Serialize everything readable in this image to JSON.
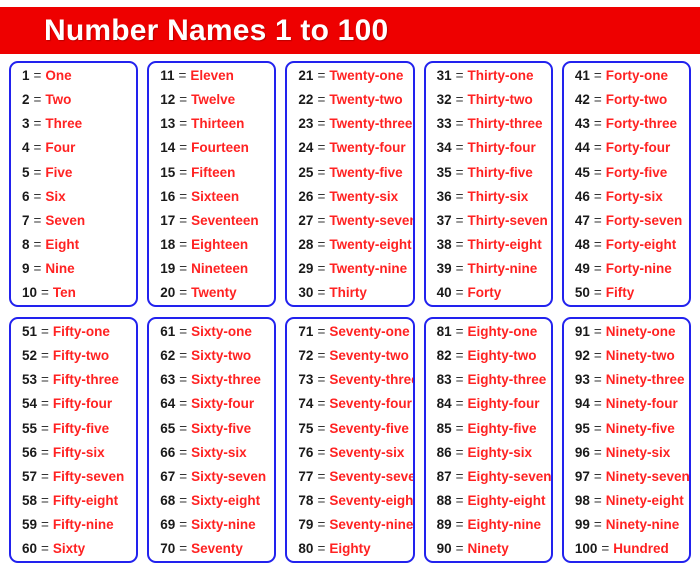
{
  "header": {
    "title": "Number Names 1 to 100",
    "banner_color": "#ee0000",
    "title_color": "#ffffff"
  },
  "style": {
    "card_border_color": "#2222ee",
    "number_color": "#1a1a1a",
    "equals_symbol": "=",
    "name_color": "#ff2222"
  },
  "cards": [
    {
      "card_name": "card-1-to-10",
      "entries": [
        {
          "number": "1",
          "eq": "=",
          "name": "One"
        },
        {
          "number": "2",
          "eq": "=",
          "name": "Two"
        },
        {
          "number": "3",
          "eq": "=",
          "name": "Three"
        },
        {
          "number": "4",
          "eq": "=",
          "name": "Four"
        },
        {
          "number": "5",
          "eq": "=",
          "name": "Five"
        },
        {
          "number": "6",
          "eq": "=",
          "name": "Six"
        },
        {
          "number": "7",
          "eq": "=",
          "name": "Seven"
        },
        {
          "number": "8",
          "eq": "=",
          "name": "Eight"
        },
        {
          "number": "9",
          "eq": "=",
          "name": "Nine"
        },
        {
          "number": "10",
          "eq": "=",
          "name": "Ten"
        }
      ]
    },
    {
      "card_name": "card-11-to-20",
      "entries": [
        {
          "number": "11",
          "eq": "=",
          "name": "Eleven"
        },
        {
          "number": "12",
          "eq": "=",
          "name": "Twelve"
        },
        {
          "number": "13",
          "eq": "=",
          "name": "Thirteen"
        },
        {
          "number": "14",
          "eq": "=",
          "name": "Fourteen"
        },
        {
          "number": "15",
          "eq": "=",
          "name": "Fifteen"
        },
        {
          "number": "16",
          "eq": "=",
          "name": "Sixteen"
        },
        {
          "number": "17",
          "eq": "=",
          "name": "Seventeen"
        },
        {
          "number": "18",
          "eq": "=",
          "name": "Eighteen"
        },
        {
          "number": "19",
          "eq": "=",
          "name": "Nineteen"
        },
        {
          "number": "20",
          "eq": "=",
          "name": "Twenty"
        }
      ]
    },
    {
      "card_name": "card-21-to-30",
      "entries": [
        {
          "number": "21",
          "eq": "=",
          "name": "Twenty-one"
        },
        {
          "number": "22",
          "eq": "=",
          "name": "Twenty-two"
        },
        {
          "number": "23",
          "eq": "=",
          "name": "Twenty-three"
        },
        {
          "number": "24",
          "eq": "=",
          "name": "Twenty-four"
        },
        {
          "number": "25",
          "eq": "=",
          "name": "Twenty-five"
        },
        {
          "number": "26",
          "eq": "=",
          "name": "Twenty-six"
        },
        {
          "number": "27",
          "eq": "=",
          "name": "Twenty-seven"
        },
        {
          "number": "28",
          "eq": "=",
          "name": "Twenty-eight"
        },
        {
          "number": "29",
          "eq": "=",
          "name": "Twenty-nine"
        },
        {
          "number": "30",
          "eq": "=",
          "name": "Thirty"
        }
      ]
    },
    {
      "card_name": "card-31-to-40",
      "entries": [
        {
          "number": "31",
          "eq": "=",
          "name": "Thirty-one"
        },
        {
          "number": "32",
          "eq": "=",
          "name": "Thirty-two"
        },
        {
          "number": "33",
          "eq": "=",
          "name": "Thirty-three"
        },
        {
          "number": "34",
          "eq": "=",
          "name": "Thirty-four"
        },
        {
          "number": "35",
          "eq": "=",
          "name": "Thirty-five"
        },
        {
          "number": "36",
          "eq": "=",
          "name": "Thirty-six"
        },
        {
          "number": "37",
          "eq": "=",
          "name": "Thirty-seven"
        },
        {
          "number": "38",
          "eq": "=",
          "name": "Thirty-eight"
        },
        {
          "number": "39",
          "eq": "=",
          "name": "Thirty-nine"
        },
        {
          "number": "40",
          "eq": "=",
          "name": "Forty"
        }
      ]
    },
    {
      "card_name": "card-41-to-50",
      "entries": [
        {
          "number": "41",
          "eq": "=",
          "name": "Forty-one"
        },
        {
          "number": "42",
          "eq": "=",
          "name": "Forty-two"
        },
        {
          "number": "43",
          "eq": "=",
          "name": "Forty-three"
        },
        {
          "number": "44",
          "eq": "=",
          "name": "Forty-four"
        },
        {
          "number": "45",
          "eq": "=",
          "name": "Forty-five"
        },
        {
          "number": "46",
          "eq": "=",
          "name": "Forty-six"
        },
        {
          "number": "47",
          "eq": "=",
          "name": "Forty-seven"
        },
        {
          "number": "48",
          "eq": "=",
          "name": "Forty-eight"
        },
        {
          "number": "49",
          "eq": "=",
          "name": "Forty-nine"
        },
        {
          "number": "50",
          "eq": "=",
          "name": "Fifty"
        }
      ]
    },
    {
      "card_name": "card-51-to-60",
      "entries": [
        {
          "number": "51",
          "eq": "=",
          "name": "Fifty-one"
        },
        {
          "number": "52",
          "eq": "=",
          "name": "Fifty-two"
        },
        {
          "number": "53",
          "eq": "=",
          "name": "Fifty-three"
        },
        {
          "number": "54",
          "eq": "=",
          "name": "Fifty-four"
        },
        {
          "number": "55",
          "eq": "=",
          "name": "Fifty-five"
        },
        {
          "number": "56",
          "eq": "=",
          "name": "Fifty-six"
        },
        {
          "number": "57",
          "eq": "=",
          "name": "Fifty-seven"
        },
        {
          "number": "58",
          "eq": "=",
          "name": "Fifty-eight"
        },
        {
          "number": "59",
          "eq": "=",
          "name": "Fifty-nine"
        },
        {
          "number": "60",
          "eq": "=",
          "name": "Sixty"
        }
      ]
    },
    {
      "card_name": "card-61-to-70",
      "entries": [
        {
          "number": "61",
          "eq": "=",
          "name": "Sixty-one"
        },
        {
          "number": "62",
          "eq": "=",
          "name": "Sixty-two"
        },
        {
          "number": "63",
          "eq": "=",
          "name": "Sixty-three"
        },
        {
          "number": "64",
          "eq": "=",
          "name": "Sixty-four"
        },
        {
          "number": "65",
          "eq": "=",
          "name": "Sixty-five"
        },
        {
          "number": "66",
          "eq": "=",
          "name": "Sixty-six"
        },
        {
          "number": "67",
          "eq": "=",
          "name": "Sixty-seven"
        },
        {
          "number": "68",
          "eq": "=",
          "name": "Sixty-eight"
        },
        {
          "number": "69",
          "eq": "=",
          "name": "Sixty-nine"
        },
        {
          "number": "70",
          "eq": "=",
          "name": "Seventy"
        }
      ]
    },
    {
      "card_name": "card-71-to-80",
      "entries": [
        {
          "number": "71",
          "eq": "=",
          "name": "Seventy-one"
        },
        {
          "number": "72",
          "eq": "=",
          "name": "Seventy-two"
        },
        {
          "number": "73",
          "eq": "=",
          "name": "Seventy-three"
        },
        {
          "number": "74",
          "eq": "=",
          "name": "Seventy-four"
        },
        {
          "number": "75",
          "eq": "=",
          "name": "Seventy-five"
        },
        {
          "number": "76",
          "eq": "=",
          "name": "Seventy-six"
        },
        {
          "number": "77",
          "eq": "=",
          "name": "Seventy-seven"
        },
        {
          "number": "78",
          "eq": "=",
          "name": "Seventy-eight"
        },
        {
          "number": "79",
          "eq": "=",
          "name": "Seventy-nine"
        },
        {
          "number": "80",
          "eq": "=",
          "name": "Eighty"
        }
      ]
    },
    {
      "card_name": "card-81-to-90",
      "entries": [
        {
          "number": "81",
          "eq": "=",
          "name": "Eighty-one"
        },
        {
          "number": "82",
          "eq": "=",
          "name": "Eighty-two"
        },
        {
          "number": "83",
          "eq": "=",
          "name": "Eighty-three"
        },
        {
          "number": "84",
          "eq": "=",
          "name": "Eighty-four"
        },
        {
          "number": "85",
          "eq": "=",
          "name": "Eighty-five"
        },
        {
          "number": "86",
          "eq": "=",
          "name": "Eighty-six"
        },
        {
          "number": "87",
          "eq": "=",
          "name": "Eighty-seven"
        },
        {
          "number": "88",
          "eq": "=",
          "name": "Eighty-eight"
        },
        {
          "number": "89",
          "eq": "=",
          "name": "Eighty-nine"
        },
        {
          "number": "90",
          "eq": "=",
          "name": "Ninety"
        }
      ]
    },
    {
      "card_name": "card-91-to-100",
      "entries": [
        {
          "number": "91",
          "eq": "=",
          "name": "Ninety-one"
        },
        {
          "number": "92",
          "eq": "=",
          "name": "Ninety-two"
        },
        {
          "number": "93",
          "eq": "=",
          "name": "Ninety-three"
        },
        {
          "number": "94",
          "eq": "=",
          "name": "Ninety-four"
        },
        {
          "number": "95",
          "eq": "=",
          "name": "Ninety-five"
        },
        {
          "number": "96",
          "eq": "=",
          "name": "Ninety-six"
        },
        {
          "number": "97",
          "eq": "=",
          "name": "Ninety-seven"
        },
        {
          "number": "98",
          "eq": "=",
          "name": "Ninety-eight"
        },
        {
          "number": "99",
          "eq": "=",
          "name": "Ninety-nine"
        },
        {
          "number": "100",
          "eq": "=",
          "name": "Hundred"
        }
      ]
    }
  ]
}
